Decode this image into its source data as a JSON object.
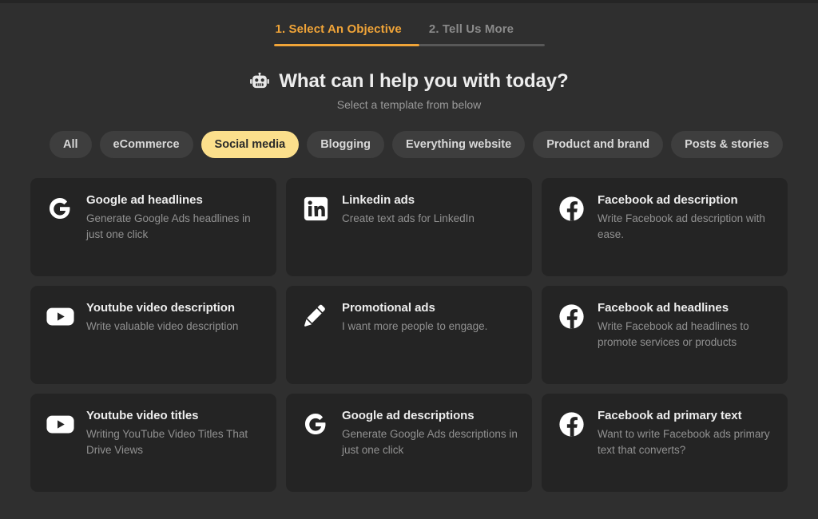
{
  "colors": {
    "background": "#2f2f2f",
    "card": "#242424",
    "accent": "#f0a438",
    "chip_selected": "#fbdf8c",
    "chip": "#3e3e3e",
    "muted_text": "#919191"
  },
  "steps": [
    {
      "label": "1. Select An Objective",
      "state": "active"
    },
    {
      "label": "2. Tell Us More",
      "state": "inactive"
    }
  ],
  "header": {
    "icon": "robot-icon",
    "title": "What can I help you with today?",
    "subtitle": "Select a template from below"
  },
  "filters": [
    {
      "label": "All",
      "selected": false
    },
    {
      "label": "eCommerce",
      "selected": false
    },
    {
      "label": "Social media",
      "selected": true
    },
    {
      "label": "Blogging",
      "selected": false
    },
    {
      "label": "Everything website",
      "selected": false
    },
    {
      "label": "Product and brand",
      "selected": false
    },
    {
      "label": "Posts & stories",
      "selected": false
    }
  ],
  "templates": [
    {
      "icon": "google-icon",
      "title": "Google ad headlines",
      "description": "Generate Google Ads headlines in just one click"
    },
    {
      "icon": "linkedin-icon",
      "title": "Linkedin ads",
      "description": "Create text ads for LinkedIn"
    },
    {
      "icon": "facebook-icon",
      "title": "Facebook ad description",
      "description": "Write Facebook ad description with ease."
    },
    {
      "icon": "youtube-icon",
      "title": "Youtube video description",
      "description": "Write valuable video description"
    },
    {
      "icon": "pencil-icon",
      "title": "Promotional ads",
      "description": "I want more people to engage."
    },
    {
      "icon": "facebook-icon",
      "title": "Facebook ad headlines",
      "description": "Write Facebook ad headlines to promote services or products"
    },
    {
      "icon": "youtube-icon",
      "title": "Youtube video titles",
      "description": "Writing YouTube Video Titles That Drive Views"
    },
    {
      "icon": "google-icon",
      "title": "Google ad descriptions",
      "description": "Generate Google Ads descriptions in just one click"
    },
    {
      "icon": "facebook-icon",
      "title": "Facebook ad primary text",
      "description": "Want to write Facebook ads primary text that converts?"
    }
  ]
}
